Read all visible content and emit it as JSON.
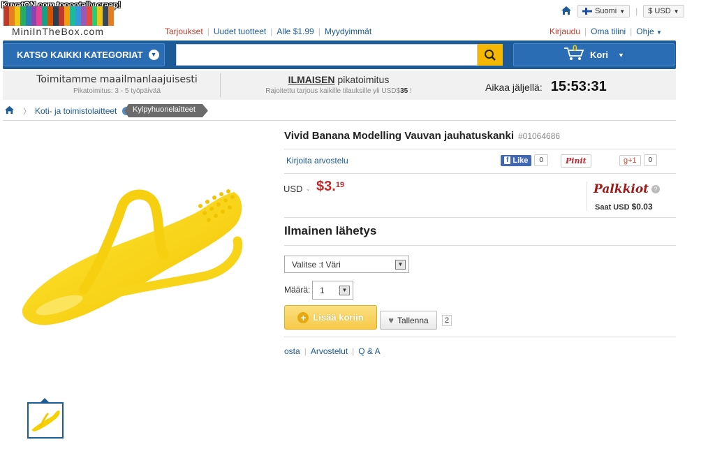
{
  "watermark": "KuvatON.com tooootally craap!",
  "logo": {
    "text": "MiniInTheBox.com",
    "bar_colors": [
      "#c0392b",
      "#e67e22",
      "#f1c40f",
      "#27ae60",
      "#2980b9",
      "#8e44ad",
      "#e84393",
      "#16a085",
      "#d35400",
      "#2c3e50",
      "#c0392b",
      "#f39c12",
      "#1abc9c",
      "#3498db",
      "#9b59b6",
      "#e74c3c",
      "#2ecc71",
      "#f1c40f",
      "#34495e",
      "#e67e22"
    ]
  },
  "top_right": {
    "home_icon": "home-icon",
    "language": "Suomi",
    "currency": "$ USD"
  },
  "top_nav": {
    "deals": "Tarjoukset",
    "new": "Uudet tuotteet",
    "under": "Alle $1.99",
    "best": "Myydyimmät"
  },
  "account_nav": {
    "login": "Kirjaudu",
    "account": "Oma tilini",
    "help": "Ohje"
  },
  "navbar": {
    "categories": "KATSO KAIKKI KATEGORIAT",
    "search_placeholder": "",
    "cart_count": "0",
    "cart": "Kori"
  },
  "info": {
    "ship_title": "Toimitamme maailmanlaajuisesti",
    "ship_sub": "Pikatoimitus: 3 - 5 työpäivää",
    "free_bold": "ILMAISEN",
    "free_rest": " pikatoimitus",
    "free_sub_a": "Rajoitettu tarjous kaikille tilauksille yli USD$",
    "free_sub_b": "35",
    "free_sub_c": " !",
    "time_label": "Aikaa jäljellä:",
    "time_value": "15:53:31"
  },
  "breadcrumb": {
    "cat": "Koti- ja toimistolaitteet",
    "current": "Kylpyhuonelaitteet"
  },
  "product": {
    "title": "Vivid Banana Modelling Vauvan jauhatuskanki",
    "sku": "#01064686",
    "review": "Kirjoita arvostelu",
    "like": "Like",
    "like_count": "0",
    "pin": "Pinit",
    "gplus": "+1",
    "gplus_count": "0",
    "currency": "USD",
    "price_main": "$3.",
    "price_cents": "19",
    "rewards": "Palkkiot",
    "rewards_get": "Saat USD",
    "rewards_amount": "$0.03",
    "free_shipping": "Ilmainen lähetys",
    "color_select": "Valitse :t Väri",
    "qty_label": "Määrä:",
    "qty_value": "1",
    "add_to_cart": "Lisää koriin",
    "save": "Tallenna",
    "save_count": "2",
    "tab_buy": "osta",
    "tab_reviews": "Arvostelut",
    "tab_qa": "Q & A"
  },
  "colors": {
    "brand_blue": "#1d5a98",
    "accent_yellow": "#f5b800",
    "price_red": "#c02b2b"
  }
}
